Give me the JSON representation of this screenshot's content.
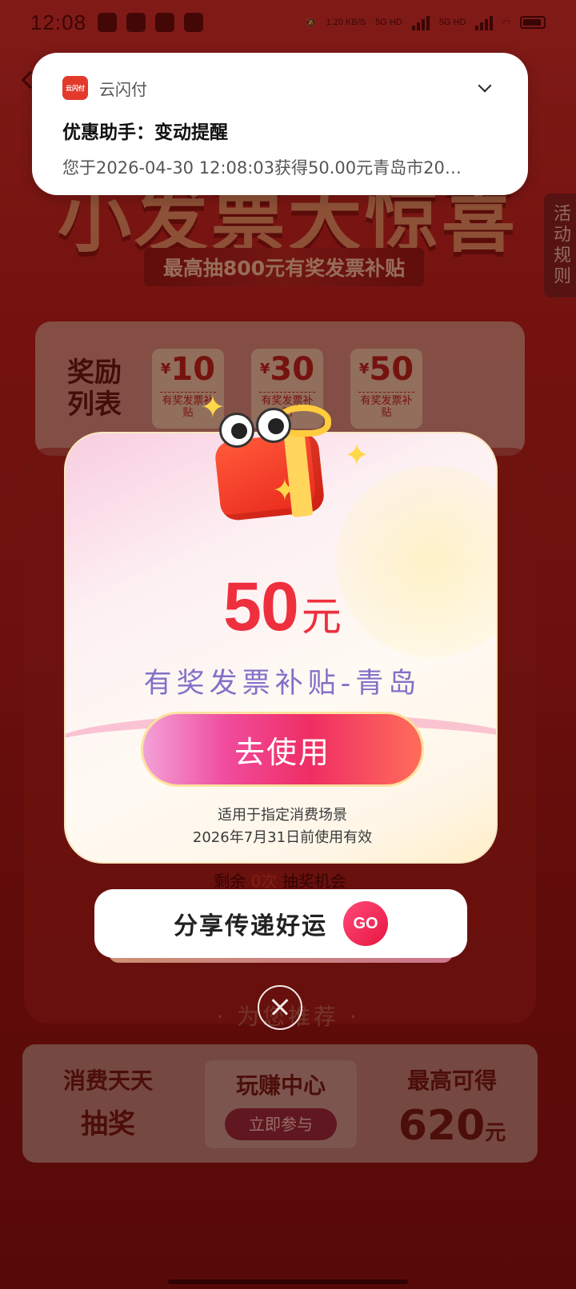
{
  "status_bar": {
    "time": "12:08",
    "net_speed": "1.20 KB/S",
    "sig1": "5G HD",
    "sig2": "5G HD"
  },
  "background": {
    "title": "小发票大惊喜",
    "subtitle": "最高抽800元有奖发票补贴",
    "rules_tab": "活动规则",
    "reward_list_title": "奖励列表",
    "rewards": [
      {
        "currency": "¥",
        "amount": "10",
        "label": "有奖发票补贴"
      },
      {
        "currency": "¥",
        "amount": "30",
        "label": "有奖发票补贴"
      },
      {
        "currency": "¥",
        "amount": "50",
        "label": "有奖发票补贴"
      }
    ],
    "remain": {
      "prefix": "剩余",
      "count": "0次",
      "suffix": "抽奖机会"
    },
    "recommend_title": "· 为您推荐 ·",
    "promo": {
      "left": {
        "t1": "消费天天",
        "t2": "抽奖"
      },
      "center": {
        "t1": "玩赚中心",
        "button": "立即参与"
      },
      "right": {
        "t1": "最高可得",
        "value": "620",
        "unit": "元"
      }
    }
  },
  "notification": {
    "app_name": "云闪付",
    "logo_text": "云闪付",
    "title": "优惠助手：变动提醒",
    "body": "您于2026-04-30 12:08:03获得50.00元青岛市20…"
  },
  "modal": {
    "amount": "50",
    "unit": "元",
    "coupon_name": "有奖发票补贴-青岛",
    "use_button": "去使用",
    "terms_line1": "适用于指定消费场景",
    "terms_line2": "2026年7月31日前使用有效"
  },
  "share": {
    "label": "分享传递好运",
    "go": "GO"
  },
  "colors": {
    "amount_red": "#ee2f3d",
    "coupon_purple": "#8270c8",
    "button_pink": "#ef2e64"
  }
}
